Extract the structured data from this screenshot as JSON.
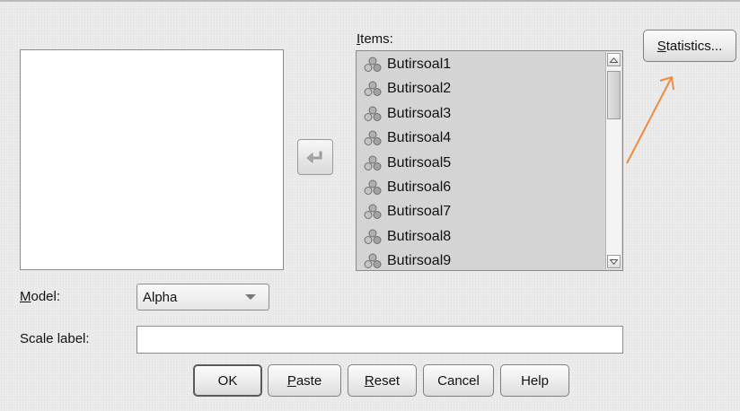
{
  "items_label": "Items:",
  "items_label_mnemonic": "I",
  "items_label_rest": "tems:",
  "items": [
    "Butirsoal1",
    "Butirsoal2",
    "Butirsoal3",
    "Butirsoal4",
    "Butirsoal5",
    "Butirsoal6",
    "Butirsoal7",
    "Butirsoal8",
    "Butirsoal9"
  ],
  "item_icon": "scale-variable-icon",
  "move_button_icon": "left-arrow-icon",
  "statistics_button": {
    "mnemonic": "S",
    "rest": "tatistics..."
  },
  "model": {
    "mnemonic": "M",
    "rest": "odel:",
    "selected": "Alpha"
  },
  "scale_label": {
    "label": "Scale label:",
    "value": ""
  },
  "buttons": {
    "ok": "OK",
    "paste": {
      "mnemonic": "P",
      "rest": "aste"
    },
    "reset": {
      "mnemonic": "R",
      "rest": "eset"
    },
    "cancel": "Cancel",
    "help": "Help"
  },
  "annotation_color": "#f08a3c"
}
